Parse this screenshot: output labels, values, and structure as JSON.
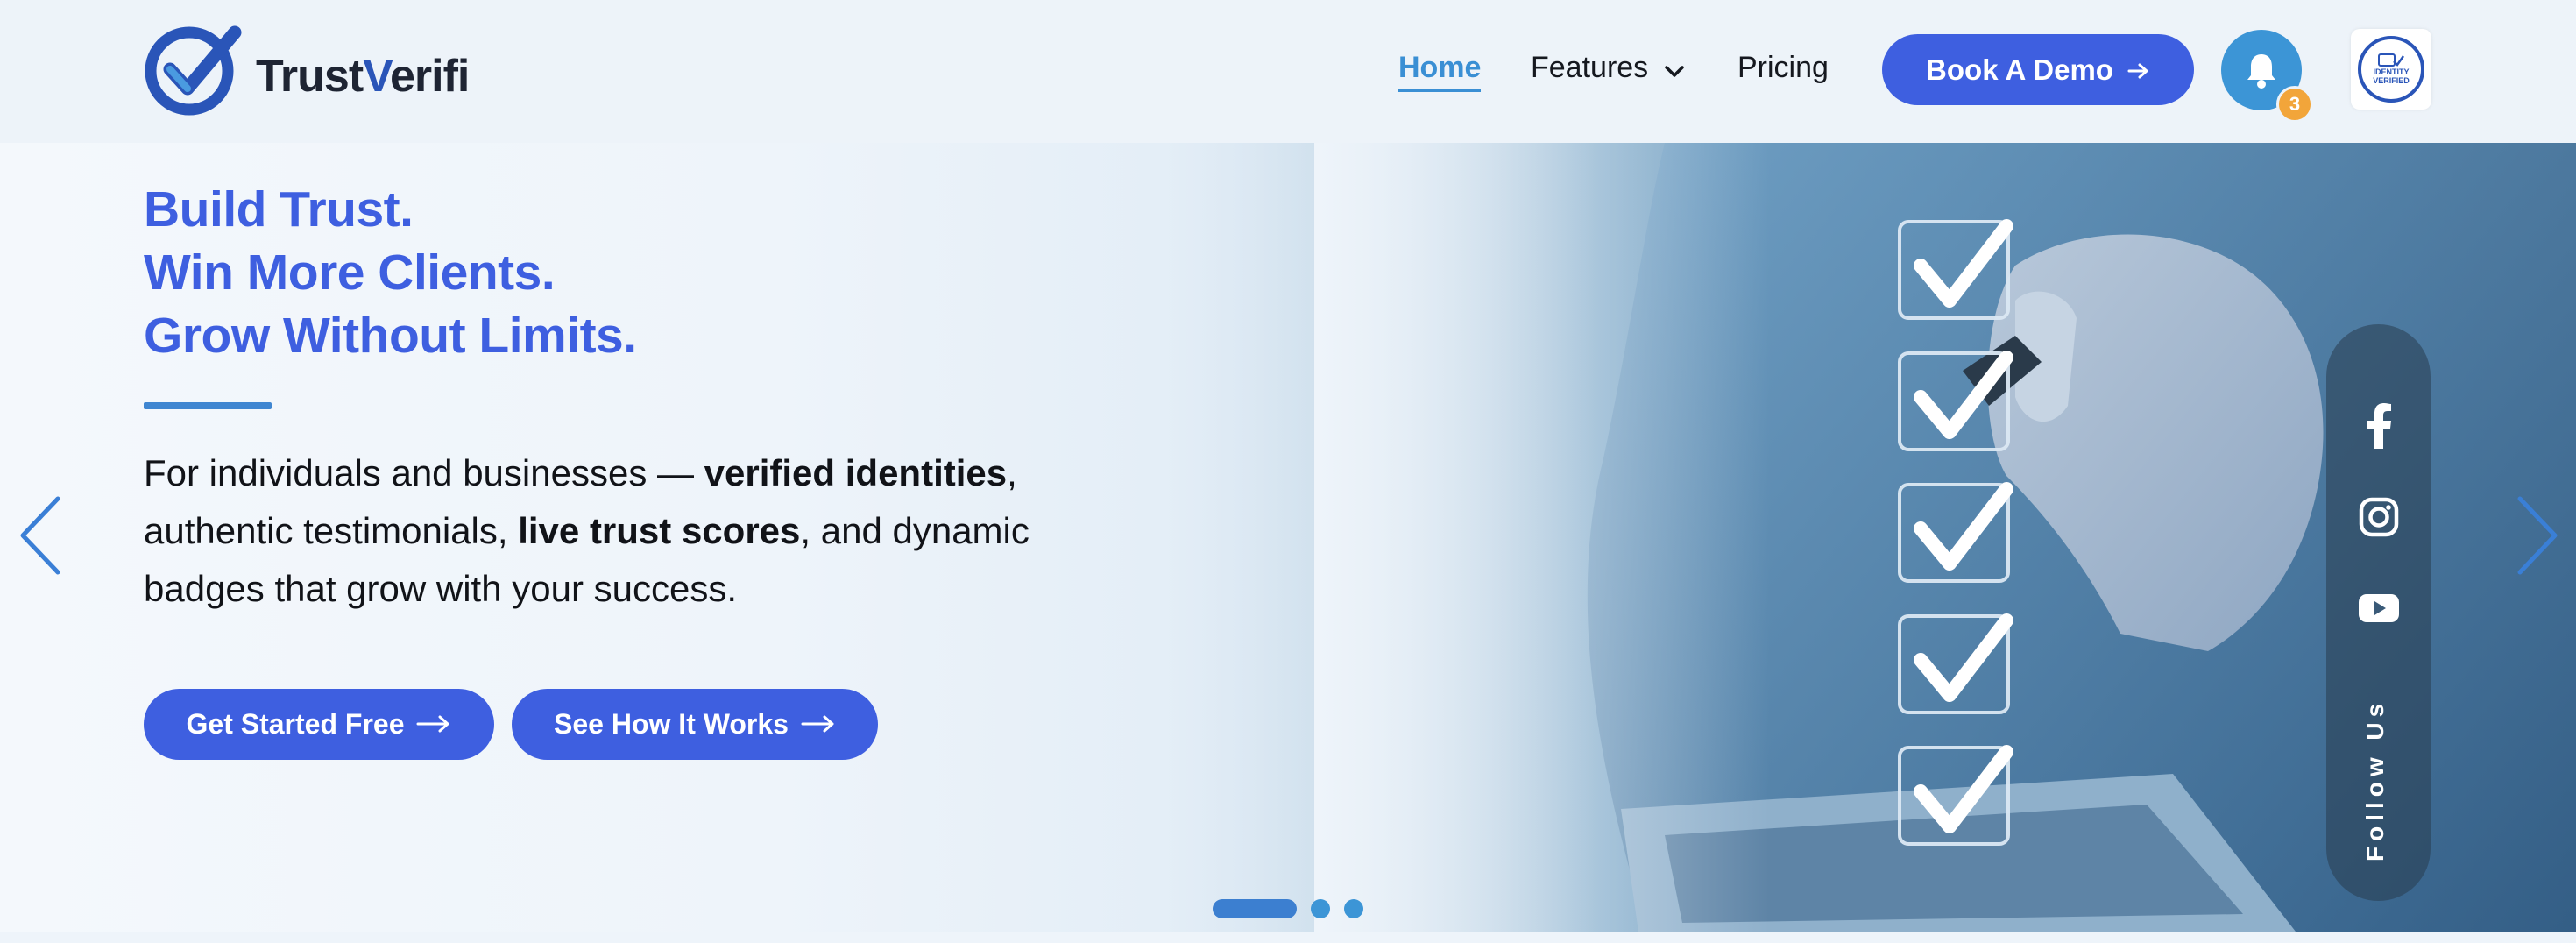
{
  "brand": {
    "name_prefix": "Trust",
    "name_v": "V",
    "name_suffix": "erifi",
    "accent": "#3e5fe0",
    "nav_active": "#3a8fd4"
  },
  "nav": {
    "home": "Home",
    "features": "Features",
    "pricing": "Pricing",
    "demo_button": "Book A Demo",
    "notification_count": "3",
    "verified_badge_line1": "IDENTITY",
    "verified_badge_line2": "VERIFIED"
  },
  "hero": {
    "title_lines": [
      "Build Trust.",
      "Win More Clients.",
      "Grow Without Limits."
    ],
    "desc_part1": "For individuals and businesses — ",
    "desc_bold1": "verified identities",
    "desc_part2": ", authentic testimonials, ",
    "desc_bold2": "live trust scores",
    "desc_part3": ", and dynamic badges that grow with your success.",
    "cta_primary": "Get Started Free",
    "cta_secondary": "See How It Works"
  },
  "slider": {
    "slide_count": 3,
    "active_index": 0
  },
  "social": {
    "label": "Follow Us",
    "icons": [
      "facebook-icon",
      "instagram-icon",
      "youtube-icon"
    ]
  }
}
